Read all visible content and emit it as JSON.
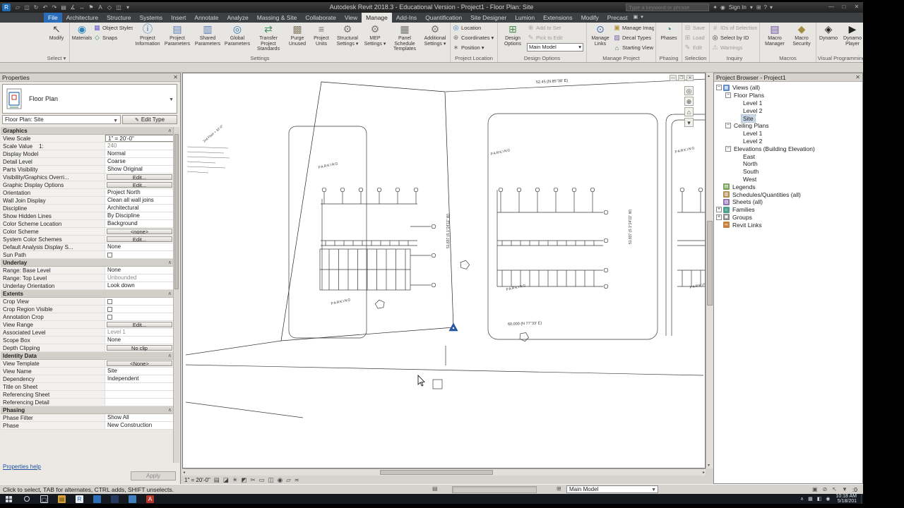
{
  "titlebar": {
    "app_letter": "R",
    "app_title": "Autodesk Revit 2018.3 - Educational Version  -  Project1 - Floor Plan: Site",
    "search_placeholder": "Type a keyword or phrase",
    "sign_in": "Sign In",
    "qat": [
      {
        "name": "open",
        "g": "▱"
      },
      {
        "name": "save",
        "g": "◫"
      },
      {
        "name": "sync",
        "g": "↻"
      },
      {
        "name": "undo",
        "g": "↶"
      },
      {
        "name": "redo",
        "g": "↷"
      },
      {
        "name": "print",
        "g": "▤"
      },
      {
        "name": "measure",
        "g": "∡"
      },
      {
        "name": "aligned-dimension",
        "g": "↔"
      },
      {
        "name": "tag",
        "g": "⚑"
      },
      {
        "name": "text",
        "g": "A"
      },
      {
        "name": "default-3d-view",
        "g": "◇"
      },
      {
        "name": "section",
        "g": "◫"
      },
      {
        "name": "customize-qat",
        "g": "▾"
      }
    ],
    "right_icons": [
      {
        "name": "exchange-apps-icon",
        "g": "✦"
      },
      {
        "name": "sign-in-avatar-icon",
        "g": "◉"
      }
    ],
    "sign_in_chevron": "▾",
    "help_icons": [
      {
        "name": "app-store-icon",
        "g": "⊞"
      },
      {
        "name": "help-icon",
        "g": "?"
      },
      {
        "name": "help-chevron-icon",
        "g": "▾"
      }
    ],
    "window_buttons": [
      {
        "name": "minimize-button",
        "g": "—"
      },
      {
        "name": "maximize-button",
        "g": "□"
      },
      {
        "name": "close-button",
        "g": "✕"
      }
    ]
  },
  "tabs": [
    {
      "label": "File",
      "file": true
    },
    {
      "label": "Architecture"
    },
    {
      "label": "Structure"
    },
    {
      "label": "Systems"
    },
    {
      "label": "Insert"
    },
    {
      "label": "Annotate"
    },
    {
      "label": "Analyze"
    },
    {
      "label": "Massing & Site"
    },
    {
      "label": "Collaborate"
    },
    {
      "label": "View"
    },
    {
      "label": "Manage",
      "active": true
    },
    {
      "label": "Add-Ins"
    },
    {
      "label": "Quantification"
    },
    {
      "label": "Site Designer"
    },
    {
      "label": "Lumion"
    },
    {
      "label": "Extensions"
    },
    {
      "label": "Modify"
    },
    {
      "label": "Precast"
    }
  ],
  "ribbon": {
    "tab_toggles": [
      {
        "name": "ribbon-display-toggle-icon",
        "g": "▣"
      },
      {
        "name": "ribbon-cycle-icon",
        "g": "▾"
      }
    ],
    "panels": [
      {
        "name": "select",
        "label": "Select ▾",
        "buttons": [
          {
            "t": "big",
            "label": "Modify",
            "icon": "cursor",
            "ic": "#4a4a4a",
            "w": 32
          }
        ]
      },
      {
        "name": "settings",
        "label": "Settings",
        "buttons": [
          {
            "t": "big",
            "label": "Materials",
            "icon": "sphere",
            "ic": "#2e86c1",
            "w": 30
          },
          {
            "t": "col",
            "w": 56,
            "items": [
              {
                "label": "Object Styles",
                "icon": "grid",
                "ic": "#6a5acd"
              },
              {
                "label": "Snaps",
                "icon": "snap",
                "ic": "#2e8b57"
              }
            ]
          },
          {
            "t": "big",
            "label": "Project Information",
            "icon": "info",
            "ic": "#2e6fb7",
            "w": 40
          },
          {
            "t": "big",
            "label": "Project Parameters",
            "icon": "params",
            "ic": "#5b7fb9",
            "w": 42
          },
          {
            "t": "big",
            "label": "Shared Parameters",
            "icon": "params2",
            "ic": "#5b7fb9",
            "w": 42
          },
          {
            "t": "big",
            "label": "Global Parameters",
            "icon": "globe",
            "ic": "#3a78b5",
            "w": 40
          },
          {
            "t": "big",
            "label": "Transfer Project Standards",
            "icon": "transfer",
            "ic": "#3f8f5f",
            "w": 46
          },
          {
            "t": "big",
            "label": "Purge Unused",
            "icon": "purge",
            "ic": "#8a7f6a",
            "w": 34
          },
          {
            "t": "big",
            "label": "Project Units",
            "icon": "units",
            "ic": "#777777",
            "w": 32
          },
          {
            "t": "big",
            "label": "Structural Settings",
            "icon": "gear",
            "ic": "#777777",
            "dd": true,
            "w": 40
          },
          {
            "t": "big",
            "label": "MEP Settings",
            "icon": "gear",
            "ic": "#777777",
            "dd": true,
            "w": 36
          },
          {
            "t": "big",
            "label": "Panel Schedule Templates",
            "icon": "table",
            "ic": "#777777",
            "w": 46
          },
          {
            "t": "big",
            "label": "Additional Settings",
            "icon": "gear",
            "ic": "#777777",
            "dd": true,
            "w": 38
          }
        ]
      },
      {
        "name": "project-location",
        "label": "Project Location",
        "buttons": [
          {
            "t": "col",
            "w": 62,
            "items": [
              {
                "label": "Location",
                "icon": "globe2",
                "ic": "#3f7fbf"
              },
              {
                "label": "Coordinates",
                "icon": "coords",
                "ic": "#777777",
                "dd": true
              },
              {
                "label": "Position",
                "icon": "position",
                "ic": "#777777",
                "dd": true
              }
            ]
          }
        ]
      },
      {
        "name": "design-options",
        "label": "Design Options",
        "buttons": [
          {
            "t": "big",
            "label": "Design Options",
            "icon": "options",
            "ic": "#4f8f4f",
            "w": 38
          },
          {
            "t": "col",
            "w": 82,
            "items": [
              {
                "label": "Add to Set",
                "icon": "add",
                "disabled": true
              },
              {
                "label": "Pick to Edit",
                "icon": "pick",
                "disabled": true
              },
              {
                "label": "Main Model",
                "combo": true
              }
            ]
          }
        ]
      },
      {
        "name": "manage-project",
        "label": "Manage Project",
        "buttons": [
          {
            "t": "big",
            "label": "Manage Links",
            "icon": "links",
            "ic": "#3a6fae",
            "w": 34
          },
          {
            "t": "col",
            "w": 58,
            "items": [
              {
                "label": "Manage Images",
                "icon": "image",
                "ic": "#b8923e"
              },
              {
                "label": "Decal Types",
                "icon": "decal",
                "ic": "#7a5f9f"
              },
              {
                "label": "Starting View",
                "icon": "home",
                "ic": "#4a7a5a"
              }
            ]
          }
        ]
      },
      {
        "name": "phasing",
        "label": "Phasing",
        "buttons": [
          {
            "t": "big",
            "label": "Phases",
            "icon": "phases",
            "ic": "#3f8f8f",
            "w": 32
          }
        ]
      },
      {
        "name": "selection",
        "label": "Selection",
        "buttons": [
          {
            "t": "col",
            "w": 34,
            "items": [
              {
                "label": "Save",
                "icon": "save",
                "disabled": true
              },
              {
                "label": "Load",
                "icon": "load",
                "disabled": true
              },
              {
                "label": "Edit",
                "icon": "edit",
                "disabled": true
              }
            ]
          }
        ]
      },
      {
        "name": "inquiry",
        "label": "Inquiry",
        "buttons": [
          {
            "t": "col",
            "w": 66,
            "items": [
              {
                "label": "IDs of Selection",
                "icon": "ids",
                "disabled": true
              },
              {
                "label": "Select by ID",
                "icon": "selectid"
              },
              {
                "label": "Warnings",
                "icon": "warning",
                "disabled": true
              }
            ]
          }
        ]
      },
      {
        "name": "macros",
        "label": "Macros",
        "buttons": [
          {
            "t": "big",
            "label": "Macro Manager",
            "icon": "macro",
            "ic": "#6a4f9f",
            "w": 38
          },
          {
            "t": "big",
            "label": "Macro Security",
            "icon": "shield",
            "ic": "#9f8f3f",
            "w": 36
          }
        ]
      },
      {
        "name": "visual-programming",
        "label": "Visual Programming",
        "buttons": [
          {
            "t": "big",
            "label": "Dynamo",
            "icon": "dynamo",
            "ic": "#222222",
            "w": 30
          },
          {
            "t": "big",
            "label": "Dynamo Player",
            "icon": "player",
            "ic": "#222222",
            "w": 36
          }
        ]
      }
    ]
  },
  "properties": {
    "header": "Properties",
    "type_category": "Floor Plan",
    "instance": "Floor Plan: Site",
    "edit_type": "Edit Type",
    "help": "Properties help",
    "apply": "Apply",
    "sections": [
      {
        "title": "Graphics",
        "rows": [
          {
            "label": "View Scale",
            "value": "1\" = 20'-0\"",
            "kind": "dropdown"
          },
          {
            "label": "Scale Value    1:",
            "value": "240",
            "kind": "gray"
          },
          {
            "label": "Display Model",
            "value": "Normal",
            "kind": "text"
          },
          {
            "label": "Detail Level",
            "value": "Coarse",
            "kind": "text"
          },
          {
            "label": "Parts Visibility",
            "value": "Show Original",
            "kind": "text"
          },
          {
            "label": "Visibility/Graphics Overri...",
            "value": "Edit...",
            "kind": "button"
          },
          {
            "label": "Graphic Display Options",
            "value": "Edit...",
            "kind": "button"
          },
          {
            "label": "Orientation",
            "value": "Project North",
            "kind": "text"
          },
          {
            "label": "Wall Join Display",
            "value": "Clean all wall joins",
            "kind": "text"
          },
          {
            "label": "Discipline",
            "value": "Architectural",
            "kind": "text"
          },
          {
            "label": "Show Hidden Lines",
            "value": "By Discipline",
            "kind": "text"
          },
          {
            "label": "Color Scheme Location",
            "value": "Background",
            "kind": "text"
          },
          {
            "label": "Color Scheme",
            "value": "<none>",
            "kind": "button"
          },
          {
            "label": "System Color Schemes",
            "value": "Edit...",
            "kind": "button"
          },
          {
            "label": "Default Analysis Display S...",
            "value": "None",
            "kind": "text"
          },
          {
            "label": "Sun Path",
            "value": "",
            "kind": "checkbox"
          }
        ]
      },
      {
        "title": "Underlay",
        "rows": [
          {
            "label": "Range: Base Level",
            "value": "None",
            "kind": "text"
          },
          {
            "label": "Range: Top Level",
            "value": "Unbounded",
            "kind": "gray"
          },
          {
            "label": "Underlay Orientation",
            "value": "Look down",
            "kind": "text"
          }
        ]
      },
      {
        "title": "Extents",
        "rows": [
          {
            "label": "Crop View",
            "value": "",
            "kind": "checkbox"
          },
          {
            "label": "Crop Region Visible",
            "value": "",
            "kind": "checkbox"
          },
          {
            "label": "Annotation Crop",
            "value": "",
            "kind": "checkbox"
          },
          {
            "label": "View Range",
            "value": "Edit...",
            "kind": "button"
          },
          {
            "label": "Associated Level",
            "value": "Level 1",
            "kind": "gray"
          },
          {
            "label": "Scope Box",
            "value": "None",
            "kind": "text"
          },
          {
            "label": "Depth Clipping",
            "value": "No clip",
            "kind": "button"
          }
        ]
      },
      {
        "title": "Identity Data",
        "rows": [
          {
            "label": "View Template",
            "value": "<None>",
            "kind": "button"
          },
          {
            "label": "View Name",
            "value": "Site",
            "kind": "text"
          },
          {
            "label": "Dependency",
            "value": "Independent",
            "kind": "text"
          },
          {
            "label": "Title on Sheet",
            "value": "",
            "kind": "text"
          },
          {
            "label": "Referencing Sheet",
            "value": "",
            "kind": "gray"
          },
          {
            "label": "Referencing Detail",
            "value": "",
            "kind": "gray"
          }
        ]
      },
      {
        "title": "Phasing",
        "rows": [
          {
            "label": "Phase Filter",
            "value": "Show All",
            "kind": "text"
          },
          {
            "label": "Phase",
            "value": "New Construction",
            "kind": "text"
          }
        ]
      }
    ]
  },
  "canvas": {
    "scale_label": "1\" = 20'-0\"",
    "parking_label": "PARKING",
    "dims": {
      "top": "52.45 (N 85°38' E)",
      "side": "51.837 (S 1°24'11\" W)",
      "side2": "51.837 (S 1°24'11\" W)",
      "bottom": "60.000 (N 77°33' E)",
      "note": "2nd Floor + 32'-0\""
    },
    "viewbar_icons": [
      {
        "name": "detail-level"
      },
      {
        "name": "visual-style"
      },
      {
        "name": "sun-path"
      },
      {
        "name": "shadows"
      },
      {
        "name": "crop-view"
      },
      {
        "name": "show-crop-region"
      },
      {
        "name": "temporary-hide-isolate"
      },
      {
        "name": "reveal-hidden-elements"
      },
      {
        "name": "temporary-view-properties"
      },
      {
        "name": "reveal-constraints"
      }
    ]
  },
  "browser": {
    "header": "Project Browser - Project1",
    "tree": [
      {
        "label": "Views (all)",
        "level": 0,
        "exp": "minus",
        "icon": "views"
      },
      {
        "label": "Floor Plans",
        "level": 1,
        "exp": "minus"
      },
      {
        "label": "Level 1",
        "level": 2
      },
      {
        "label": "Level 2",
        "level": 2
      },
      {
        "label": "Site",
        "level": 2,
        "selected": true
      },
      {
        "label": "Ceiling Plans",
        "level": 1,
        "exp": "minus"
      },
      {
        "label": "Level 1",
        "level": 2
      },
      {
        "label": "Level 2",
        "level": 2
      },
      {
        "label": "Elevations (Building Elevation)",
        "level": 1,
        "exp": "minus"
      },
      {
        "label": "East",
        "level": 2
      },
      {
        "label": "North",
        "level": 2
      },
      {
        "label": "South",
        "level": 2
      },
      {
        "label": "West",
        "level": 2
      },
      {
        "label": "Legends",
        "level": 0,
        "icon": "legends"
      },
      {
        "label": "Schedules/Quantities (all)",
        "level": 0,
        "icon": "schedules"
      },
      {
        "label": "Sheets (all)",
        "level": 0,
        "icon": "sheets"
      },
      {
        "label": "Families",
        "level": 0,
        "exp": "plus",
        "icon": "families"
      },
      {
        "label": "Groups",
        "level": 0,
        "exp": "plus",
        "icon": "groups"
      },
      {
        "label": "Revit Links",
        "level": 0,
        "icon": "links"
      }
    ]
  },
  "statusbar": {
    "message": "Click to select, TAB for alternates, CTRL adds, SHIFT unselects.",
    "main_model": "Main Model",
    "filter_count": ":0",
    "left_icons": [
      {
        "name": "worksets-icon",
        "g": "▤"
      },
      {
        "name": "design-options-icon",
        "g": "⊞"
      }
    ],
    "right_icons": [
      {
        "name": "editable-only-icon",
        "g": "▣"
      },
      {
        "name": "exclude-options-icon",
        "g": "⊘"
      },
      {
        "name": "press-drag-icon",
        "g": "↖"
      },
      {
        "name": "filter-icon",
        "g": "▼"
      }
    ]
  },
  "taskbar": {
    "time": "10:18 AM",
    "date": "5/18/201",
    "apps": [
      {
        "name": "start",
        "kind": "start"
      },
      {
        "name": "search",
        "kind": "circle"
      },
      {
        "name": "task-view",
        "ch": "▢",
        "bg": "transparent",
        "fg": "#cfd8df"
      },
      {
        "name": "file-explorer",
        "ch": "▤",
        "bg": "#d9a33c",
        "fg": "#5c4710"
      },
      {
        "name": "revit",
        "ch": "R",
        "bg": "#e8edf2",
        "fg": "#1a62a8"
      },
      {
        "name": "app-blue",
        "ch": "",
        "bg": "#2e6fb7",
        "fg": "#fff"
      },
      {
        "name": "app-navy",
        "ch": "",
        "bg": "#233a5e",
        "fg": "#cfd8df"
      },
      {
        "name": "app-teal",
        "ch": "",
        "bg": "#3f7fbf",
        "fg": "#fff"
      },
      {
        "name": "autocad",
        "ch": "A",
        "bg": "#b5342a",
        "fg": "#fff"
      }
    ],
    "tray": [
      {
        "name": "tray-chevron-icon",
        "g": "∧"
      },
      {
        "name": "tray-network-icon",
        "g": "▦"
      },
      {
        "name": "tray-volume-icon",
        "g": "◧"
      },
      {
        "name": "tray-notification-icon",
        "g": "◉"
      }
    ]
  }
}
